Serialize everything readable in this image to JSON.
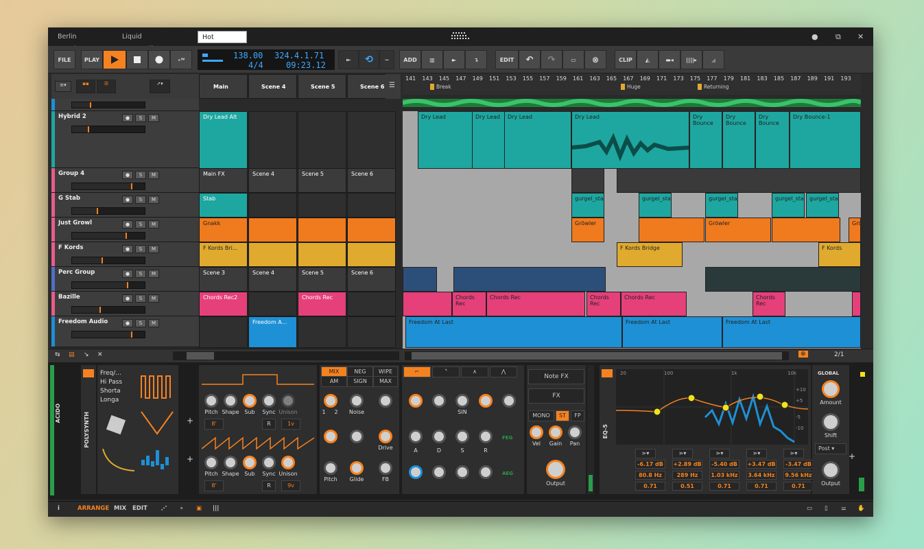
{
  "tabs": [
    "Berlin Mornings",
    "Liquid Trommelfeuer",
    "Hot Lemon"
  ],
  "toolbar": {
    "file": "FILE",
    "play": "PLAY",
    "tempo": "138.00",
    "position": "324.4.1.71",
    "signature": "4/4",
    "time": "09:23.12",
    "add": "ADD",
    "edit": "EDIT",
    "clip": "CLIP"
  },
  "ruler": {
    "bars": [
      "141",
      "143",
      "145",
      "147",
      "149",
      "151",
      "153",
      "155",
      "157",
      "159",
      "161",
      "163",
      "165",
      "167",
      "169",
      "171",
      "173",
      "175",
      "177",
      "179",
      "181",
      "183",
      "185",
      "187",
      "189",
      "191",
      "193"
    ],
    "markers": [
      "Break",
      "Huge",
      "Returning"
    ]
  },
  "scene_headers": [
    "Main",
    "Scene 4",
    "Scene 5",
    "Scene 6"
  ],
  "tracks": [
    {
      "name": "Hybrid 2",
      "color": "#1ea7a0"
    },
    {
      "name": "Group 4",
      "color": "#e85c8a"
    },
    {
      "name": "G Stab",
      "color": "#e85c8a"
    },
    {
      "name": "Just Growl",
      "color": "#e85c8a"
    },
    {
      "name": "F Kords",
      "color": "#e85c8a"
    },
    {
      "name": "Perc Group",
      "color": "#4f6fc7"
    },
    {
      "name": "Bazille",
      "color": "#e85c8a"
    },
    {
      "name": "Freedom Audio",
      "color": "#1e90d6"
    }
  ],
  "launcher": {
    "row_hybrid": "Dry Lead Alt",
    "group_row": [
      "Main FX",
      "Scene 4",
      "Scene 5",
      "Scene 6"
    ],
    "stab": "Stab",
    "gnakk": "Gnakk",
    "fkords": "F Kords Bri...",
    "perc_row": [
      "Scene 3",
      "Scene 4",
      "Scene 5",
      "Scene 6"
    ],
    "chords": [
      "Chords Rec2",
      "Chords Rec"
    ],
    "freedom": "Freedom A..."
  },
  "arranger": {
    "dry": [
      "Dry Lead",
      "Dry Lead",
      "Dry Lead",
      "Dry Lead",
      "Dry Bounce",
      "Dry Bounce",
      "Dry Bounce",
      "Dry Bounce-1"
    ],
    "gurgel": "gurgel_stal",
    "growler": [
      "Gröwler",
      "Gröwler",
      "Gröwl"
    ],
    "fkb": "F Kords Bridge",
    "fk": "F Kords",
    "chords": [
      "Chords Rec",
      "Chords Rec",
      "Chords Rec",
      "Chords Rec",
      "Chords Rec"
    ],
    "freedom": [
      "Freedom At Last",
      "Freedom At Last",
      "Freedom At Last"
    ]
  },
  "page_counter": "2/1",
  "devices": {
    "acido": "ACIDO",
    "polysynth": "POLYSYNTH",
    "mods": [
      "Freq/...",
      "Hi Pass",
      "Shorta",
      "Longa"
    ],
    "osc_labels": [
      "Pitch",
      "Shape",
      "Sub",
      "Sync",
      "Unison"
    ],
    "osc1_vals": [
      "8'",
      "R",
      "1v"
    ],
    "osc2_vals": [
      "8'",
      "R",
      "9v"
    ],
    "mix": [
      "MIX",
      "NEG",
      "WIPE",
      "AM",
      "SIGN",
      "MAX"
    ],
    "mix_labels": [
      "1",
      "2",
      "Noise"
    ],
    "filter_labels": [
      "Drive",
      "Pitch",
      "Glide",
      "FB"
    ],
    "env_labels": [
      "SIN",
      "A",
      "D",
      "S",
      "R"
    ],
    "feg": "FEG",
    "aeg": "AEG",
    "notefx": "Note FX",
    "fx": "FX",
    "mono": "MONO",
    "st": "ST",
    "fp": "FP",
    "out_labels": [
      "Vel",
      "Gain",
      "Pan",
      "Output"
    ],
    "eq": "EQ-5",
    "eq_freq_axis": [
      "20",
      "100",
      "1k",
      "10k"
    ],
    "eq_db_axis": [
      "+10",
      "+5",
      "-5",
      "-10"
    ],
    "eq_bands": [
      "1",
      "2",
      "3",
      "4",
      "5"
    ],
    "eq_gain": [
      "-6.17 dB",
      "+2.89 dB",
      "-5.40 dB",
      "+3.47 dB",
      "-3.47 dB"
    ],
    "eq_freq": [
      "80.8 Hz",
      "289 Hz",
      "1.03 kHz",
      "3.64 kHz",
      "9.56 kHz"
    ],
    "eq_q": [
      "0.71",
      "0.51",
      "0.71",
      "0.71",
      "0.71"
    ],
    "global": "GLOBAL",
    "amount": "Amount",
    "shift": "Shift",
    "post": "Post",
    "output": "Output"
  },
  "bottom": {
    "arrange": "ARRANGE",
    "mix": "MIX",
    "edit": "EDIT"
  },
  "colors": {
    "accent": "#f58220",
    "teal": "#1ea7a0",
    "orange": "#f07a1e",
    "yellow": "#e0aa2e",
    "pink": "#e5407a",
    "blue": "#1e90d6",
    "green": "#2a9d4a"
  }
}
